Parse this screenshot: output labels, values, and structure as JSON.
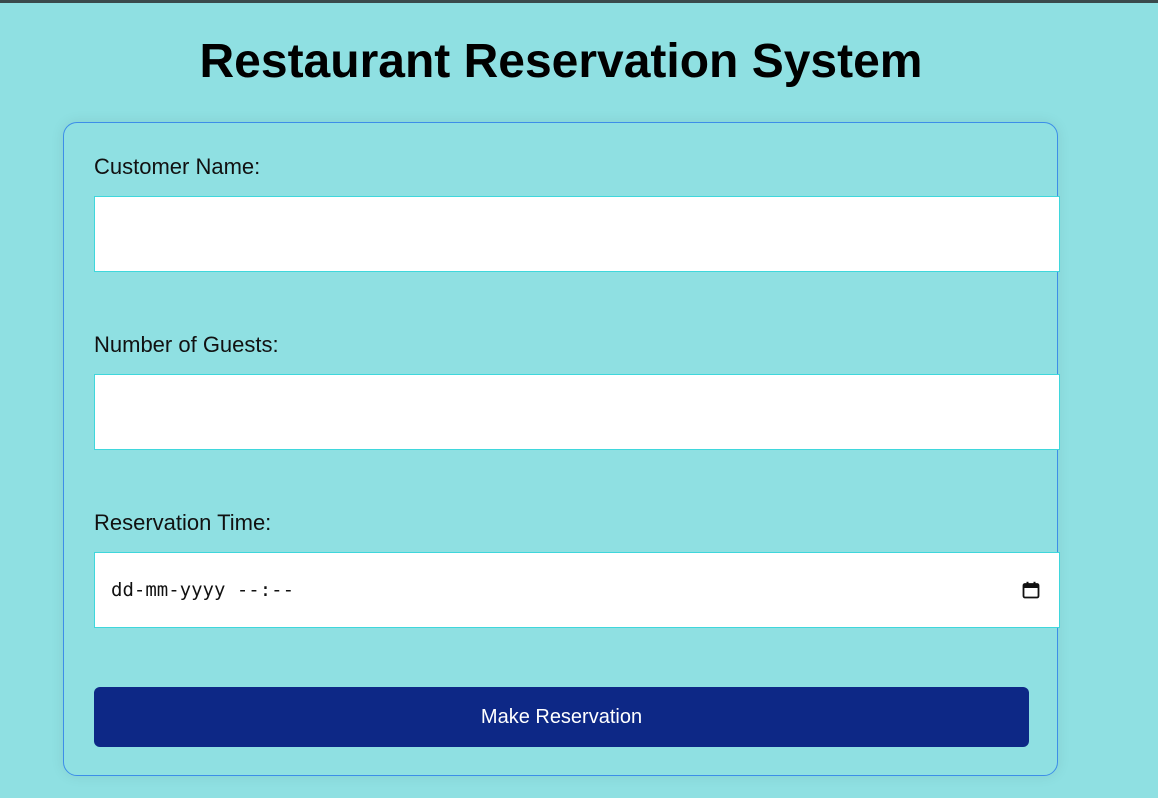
{
  "page": {
    "title": "Restaurant Reservation System"
  },
  "form": {
    "customer_name": {
      "label": "Customer Name:",
      "value": ""
    },
    "guests": {
      "label": "Number of Guests:",
      "value": ""
    },
    "reservation_time": {
      "label": "Reservation Time:",
      "placeholder": "dd-mm-yyyy --:--",
      "icon": "calendar-icon"
    },
    "submit_label": "Make Reservation"
  },
  "colors": {
    "background": "#8fe0e2",
    "button": "#0d2886",
    "card_border": "#3d8ee8",
    "input_border": "#3fd7dc"
  }
}
